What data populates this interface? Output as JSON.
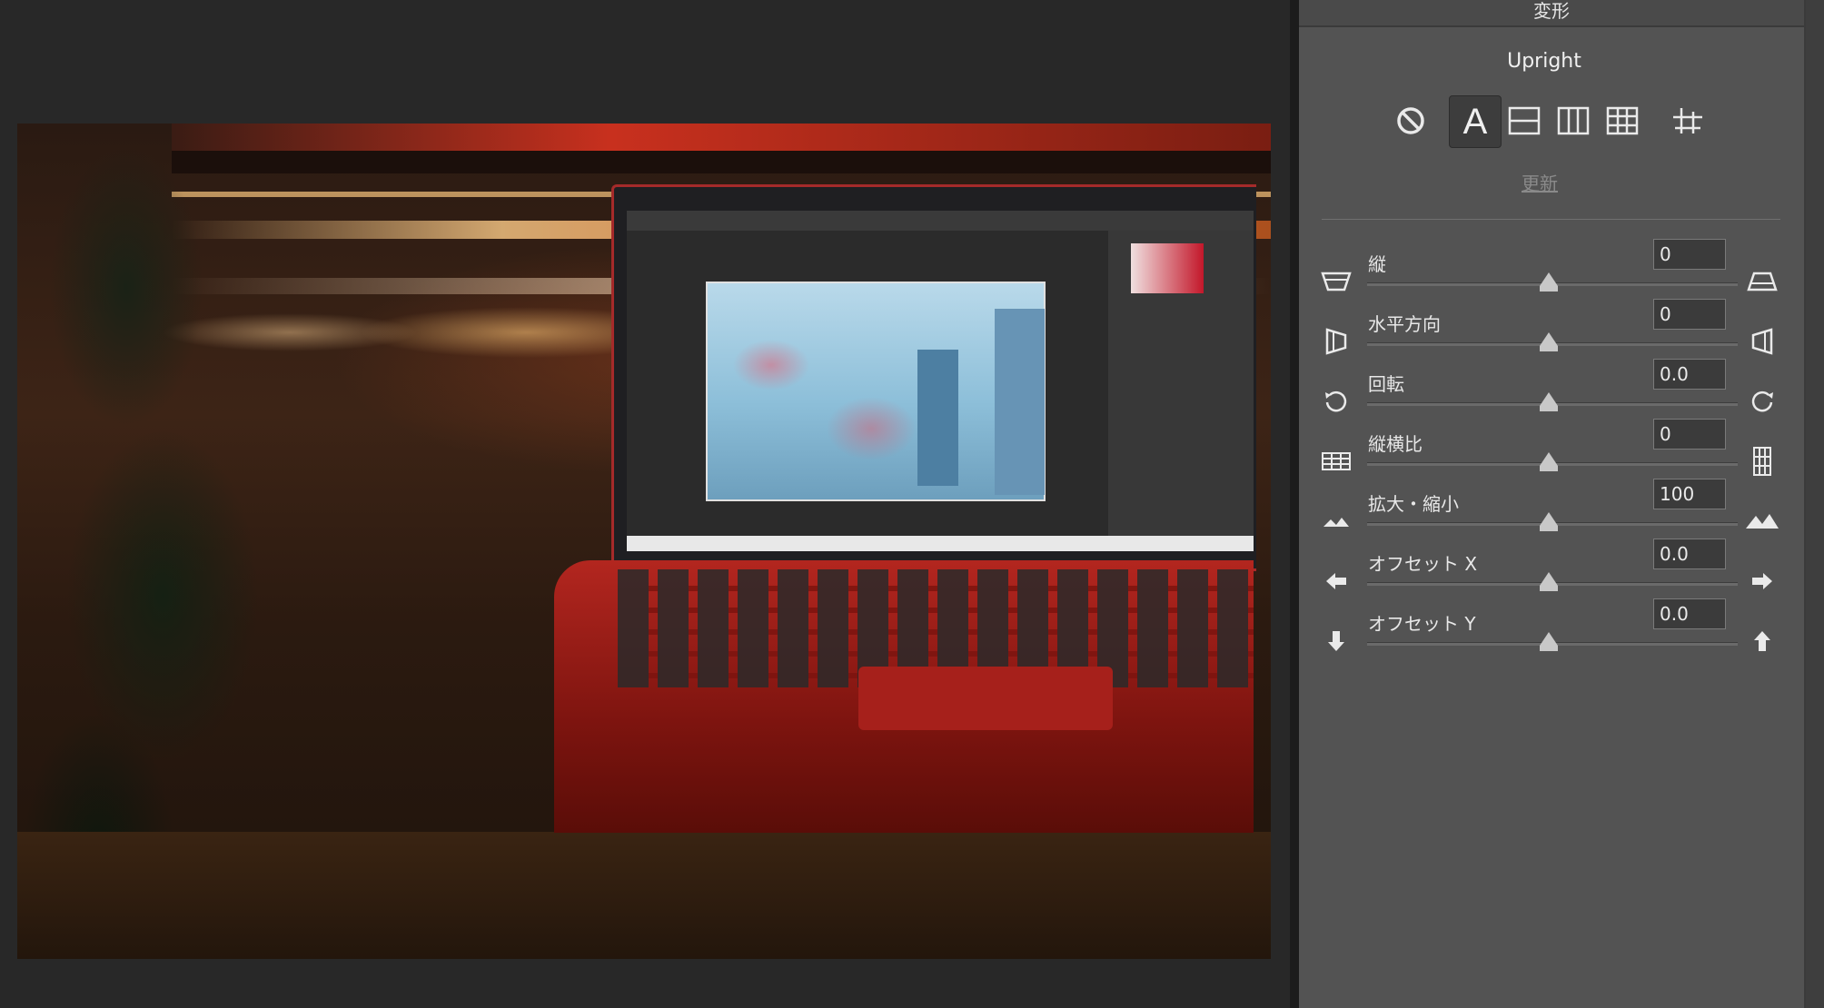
{
  "panel": {
    "section_title": "変形",
    "upright": {
      "label": "Upright",
      "update_label": "更新",
      "auto_letter": "A",
      "buttons": [
        {
          "name": "off-icon",
          "active": false
        },
        {
          "name": "auto-icon",
          "active": true
        },
        {
          "name": "level-icon",
          "active": false
        },
        {
          "name": "vertical-icon",
          "active": false
        },
        {
          "name": "full-icon",
          "active": false
        },
        {
          "name": "guided-icon",
          "active": false
        }
      ]
    },
    "sliders": [
      {
        "id": "vertical",
        "label": "縦",
        "value": "0",
        "icon_left": "perspective-vertical-top-icon",
        "icon_right": "perspective-vertical-bottom-icon"
      },
      {
        "id": "horizontal",
        "label": "水平方向",
        "value": "0",
        "icon_left": "perspective-horizontal-left-icon",
        "icon_right": "perspective-horizontal-right-icon"
      },
      {
        "id": "rotate",
        "label": "回転",
        "value": "0.0",
        "icon_left": "rotate-left-icon",
        "icon_right": "rotate-right-icon"
      },
      {
        "id": "aspect",
        "label": "縦横比",
        "value": "0",
        "icon_left": "aspect-wide-icon",
        "icon_right": "aspect-tall-icon"
      },
      {
        "id": "scale",
        "label": "拡大・縮小",
        "value": "100",
        "icon_left": "scale-down-icon",
        "icon_right": "scale-up-icon"
      },
      {
        "id": "offset-x",
        "label": "オフセット X",
        "value": "0.0",
        "icon_left": "arrow-left-icon",
        "icon_right": "arrow-right-icon"
      },
      {
        "id": "offset-y",
        "label": "オフセット Y",
        "value": "0.0",
        "icon_left": "arrow-down-icon",
        "icon_right": "arrow-up-icon"
      }
    ]
  },
  "colors": {
    "panel_bg": "#535353",
    "canvas_bg": "#282828",
    "accent_active": "#3d3d3d"
  }
}
